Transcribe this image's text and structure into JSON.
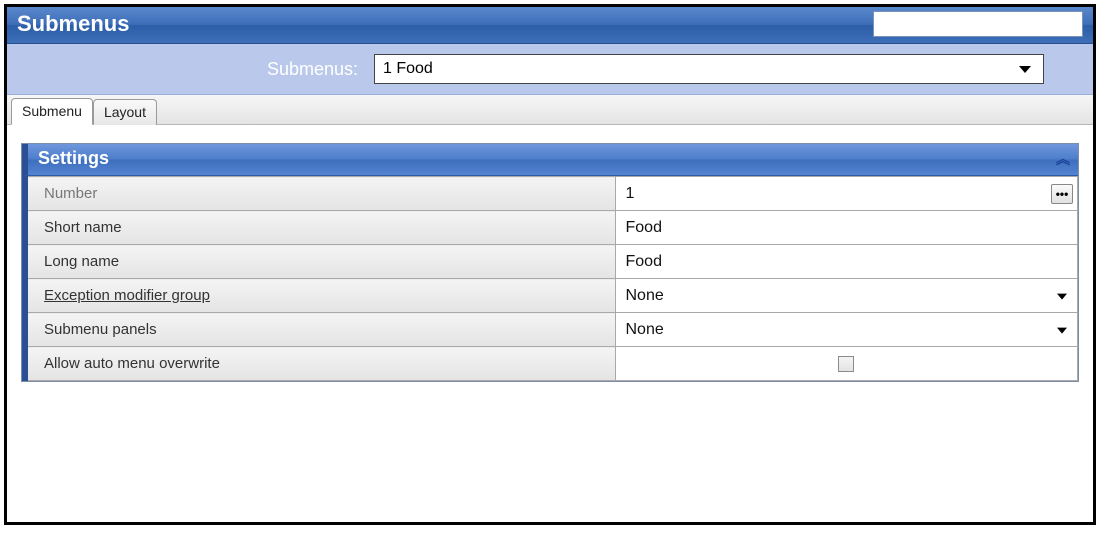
{
  "header": {
    "title": "Submenus",
    "search_value": ""
  },
  "selector": {
    "label": "Submenus:",
    "value": "1 Food"
  },
  "tabs": [
    {
      "label": "Submenu",
      "active": true
    },
    {
      "label": "Layout",
      "active": false
    }
  ],
  "panel": {
    "title": "Settings",
    "rows": {
      "number": {
        "label": "Number",
        "value": "1",
        "type": "ellipsis",
        "focused": true
      },
      "short": {
        "label": "Short name",
        "value": "Food",
        "type": "text"
      },
      "long": {
        "label": "Long name",
        "value": "Food",
        "type": "text"
      },
      "exc": {
        "label": "Exception modifier group",
        "value": "None",
        "type": "dropdown",
        "link": true
      },
      "panels": {
        "label": "Submenu panels",
        "value": "None",
        "type": "dropdown"
      },
      "auto": {
        "label": "Allow auto menu overwrite",
        "value": "",
        "type": "checkbox",
        "checked": false
      }
    }
  }
}
